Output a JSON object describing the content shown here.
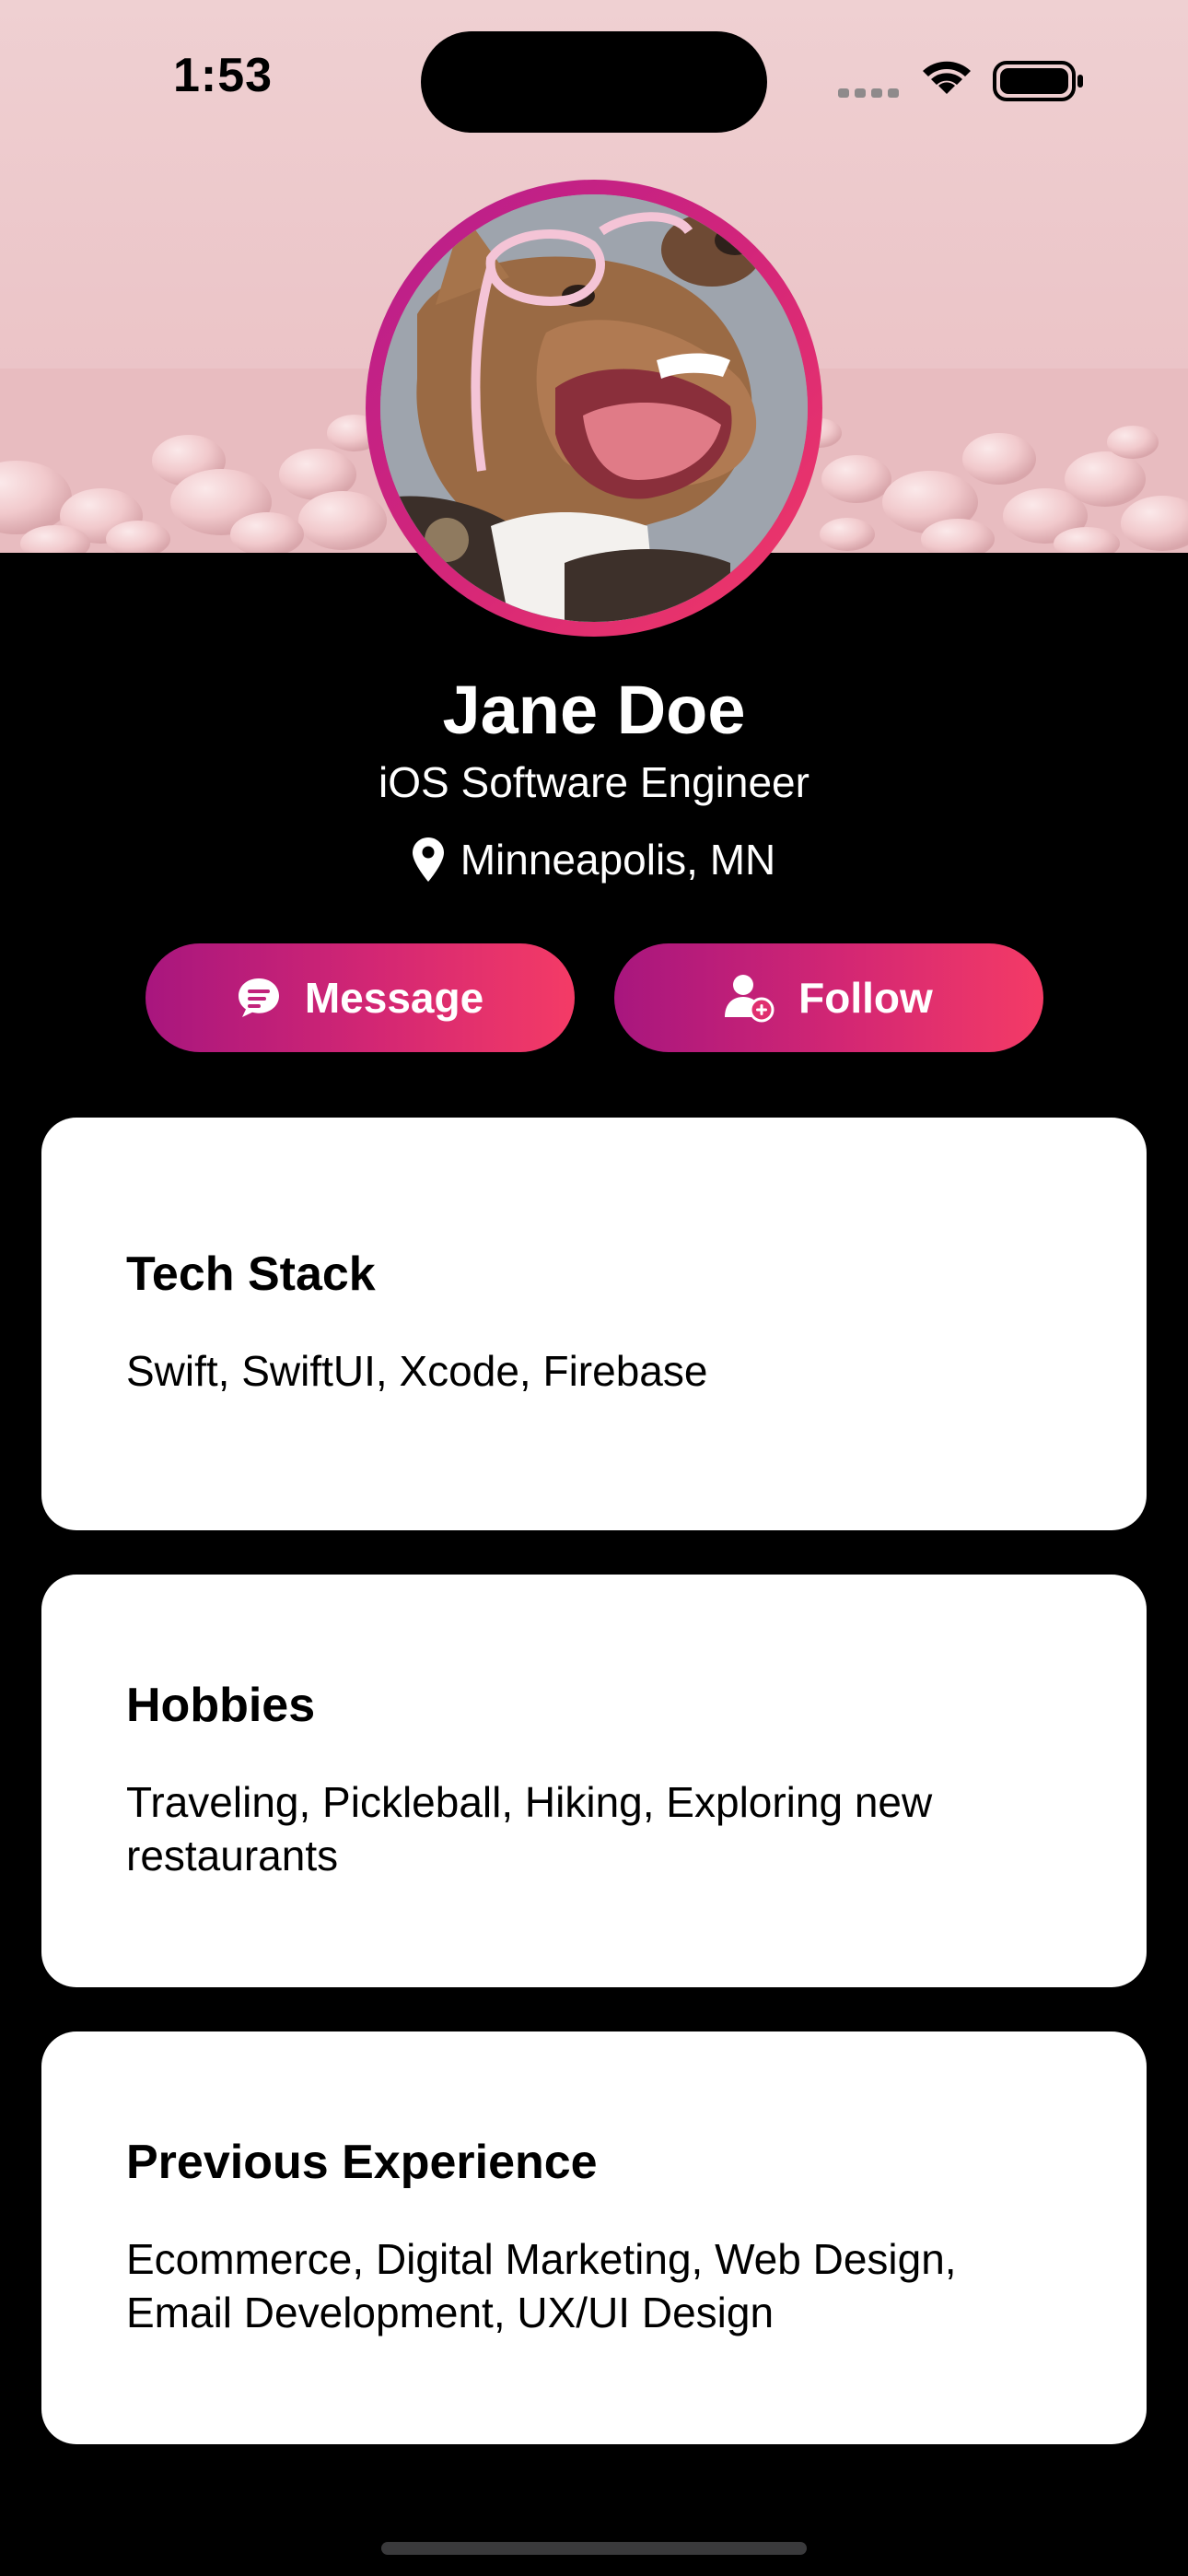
{
  "status_bar": {
    "time": "1:53"
  },
  "profile": {
    "name": "Jane Doe",
    "title": "iOS Software Engineer",
    "location": "Minneapolis, MN"
  },
  "actions": {
    "message_label": "Message",
    "follow_label": "Follow"
  },
  "cards": [
    {
      "heading": "Tech Stack",
      "body": "Swift, SwiftUI, Xcode, Firebase"
    },
    {
      "heading": "Hobbies",
      "body": "Traveling, Pickleball, Hiking, Exploring new restaurants"
    },
    {
      "heading": "Previous Experience",
      "body": "Ecommerce, Digital Marketing, Web Design, Email Development, UX/UI Design"
    }
  ],
  "colors": {
    "gradient_start": "#a8167e",
    "gradient_end": "#f43b66",
    "banner": "#efd0d2",
    "background": "#000000",
    "card": "#ffffff"
  },
  "icons": {
    "location": "location-pin-icon",
    "message": "message-bubble-icon",
    "follow": "person-add-icon"
  }
}
